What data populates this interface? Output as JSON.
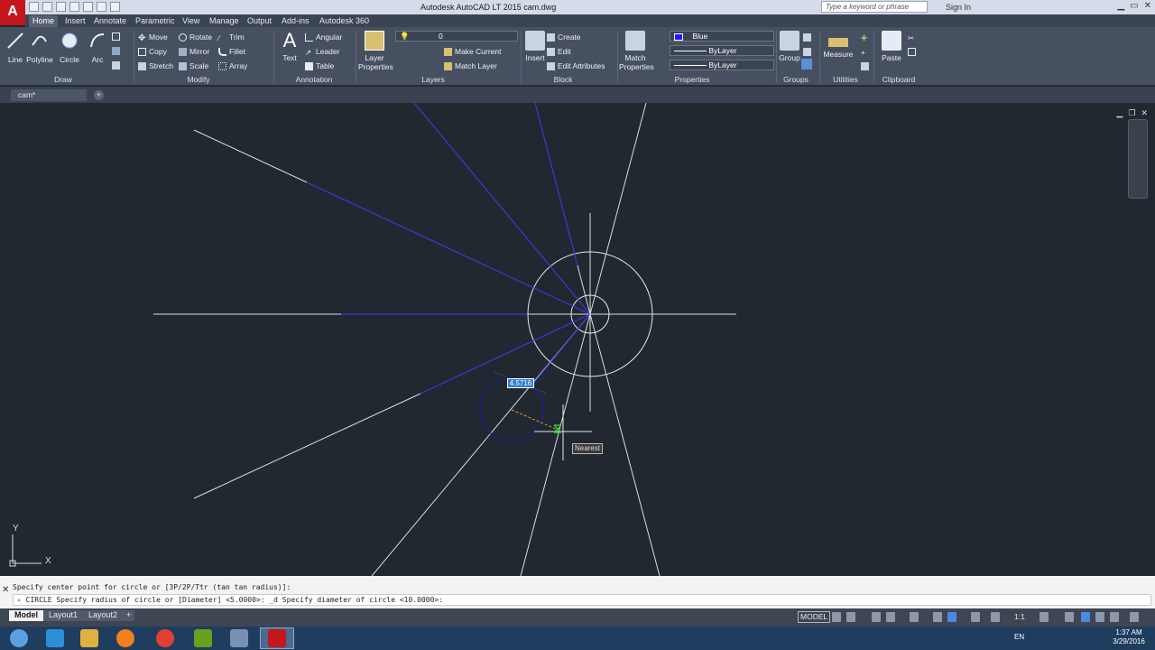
{
  "app": {
    "logo": "A",
    "title": "Autodesk AutoCAD LT 2015    cam.dwg",
    "search_placeholder": "Type a keyword or phrase",
    "signin": "Sign In"
  },
  "ribbon_tabs": [
    "Home",
    "Insert",
    "Annotate",
    "Parametric",
    "View",
    "Manage",
    "Output",
    "Add-ins",
    "Autodesk 360"
  ],
  "ribbon": {
    "draw": {
      "title": "Draw",
      "line": "Line",
      "polyline": "Polyline",
      "circle": "Circle",
      "arc": "Arc"
    },
    "modify": {
      "title": "Modify",
      "move": "Move",
      "rotate": "Rotate",
      "trim": "Trim",
      "copy": "Copy",
      "mirror": "Mirror",
      "fillet": "Fillet",
      "stretch": "Stretch",
      "scale": "Scale",
      "array": "Array"
    },
    "annotation": {
      "title": "Annotation",
      "text": "Text",
      "angular": "Angular",
      "leader": "Leader",
      "table": "Table"
    },
    "layers": {
      "title": "Layers",
      "layer_properties_1": "Layer",
      "layer_properties_2": "Properties",
      "current_layer": "0",
      "make_current": "Make Current",
      "match_layer": "Match Layer"
    },
    "block": {
      "title": "Block",
      "insert": "Insert",
      "create": "Create",
      "edit": "Edit",
      "edit_attributes": "Edit Attributes"
    },
    "properties": {
      "title": "Properties",
      "match_1": "Match",
      "match_2": "Properties",
      "color": "Blue",
      "linetype": "ByLayer",
      "lineweight": "ByLayer"
    },
    "groups": {
      "title": "Groups",
      "group": "Group"
    },
    "utilities": {
      "title": "Utilities",
      "measure": "Measure"
    },
    "clipboard": {
      "title": "Clipboard",
      "paste": "Paste"
    }
  },
  "file_tab": {
    "name": "cam*"
  },
  "drawing": {
    "dynamic_input_value": "4.5716",
    "snap_tooltip": "Nearest",
    "ucs_x": "X",
    "ucs_y": "Y"
  },
  "command": {
    "history": "Specify center point for circle or [3P/2P/Ttr (tan tan radius)]:",
    "current": "CIRCLE Specify radius of circle or [Diameter] <5.0000>: _d Specify diameter of circle <10.0000>:"
  },
  "layout_tabs": [
    "Model",
    "Layout1",
    "Layout2"
  ],
  "status": {
    "model": "MODEL",
    "scale": "1:1"
  },
  "taskbar": {
    "lang": "EN",
    "time": "1:37 AM",
    "date": "3/29/2016"
  },
  "colors": {
    "accent_blue": "#3c3cd8",
    "layer_blue_swatch": "#1a1aff",
    "autocad_red": "#c4161c"
  }
}
